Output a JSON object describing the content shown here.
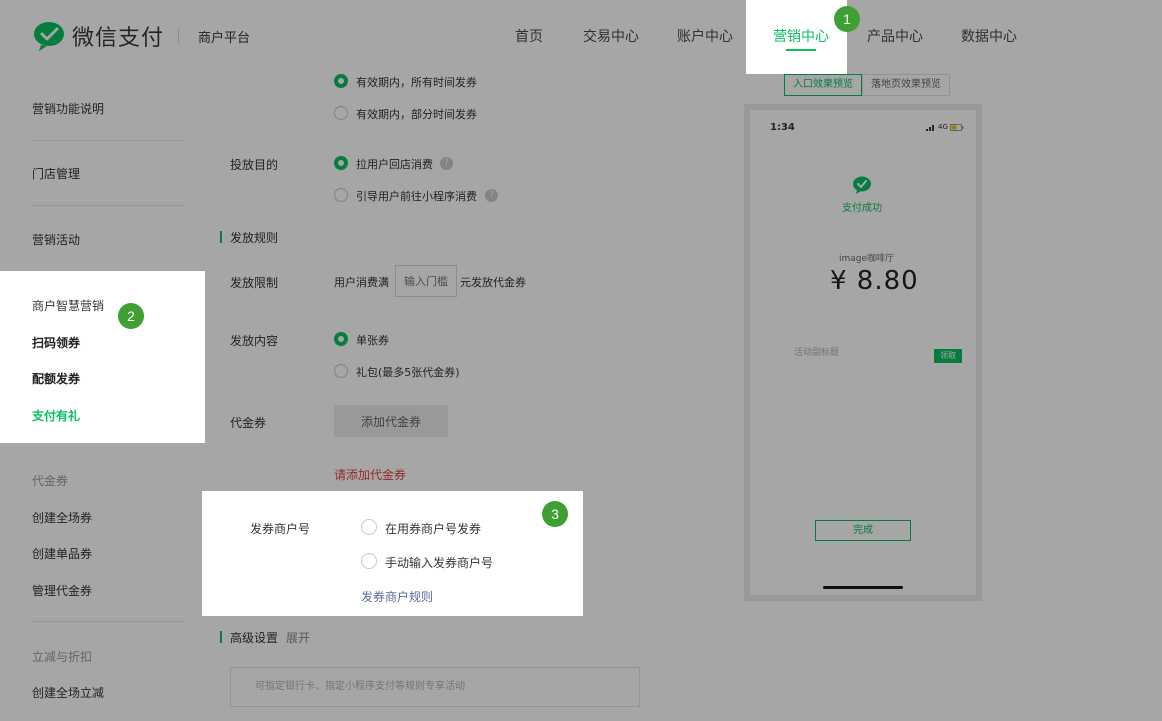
{
  "header": {
    "logo_text": "微信支付",
    "platform": "商户平台",
    "nav": [
      {
        "label": "首页"
      },
      {
        "label": "交易中心"
      },
      {
        "label": "账户中心"
      },
      {
        "label": "营销中心",
        "active": true
      },
      {
        "label": "产品中心"
      },
      {
        "label": "数据中心"
      }
    ]
  },
  "sidebar": {
    "items": [
      {
        "label": "营销功能说明"
      },
      {
        "label": "门店管理"
      },
      {
        "label": "营销活动"
      },
      {
        "label": "商户智慧营销"
      },
      {
        "label": "扫码领券"
      },
      {
        "label": "配额发券"
      },
      {
        "label": "支付有礼",
        "active": true
      },
      {
        "label": "代金券"
      },
      {
        "label": "创建全场券"
      },
      {
        "label": "创建单品券"
      },
      {
        "label": "管理代金券"
      },
      {
        "label": "立减与折扣"
      },
      {
        "label": "创建全场立减"
      }
    ]
  },
  "form": {
    "time_option_all": "有效期内，所有时间发券",
    "time_option_partial": "有效期内，部分时间发券",
    "purpose_label": "投放目的",
    "purpose_store": "拉用户回店消费",
    "purpose_miniprogram": "引导用户前往小程序消费",
    "rules_title": "发放规则",
    "limit_label": "发放限制",
    "limit_prefix": "用户消费满",
    "limit_placeholder": "输入门槛",
    "limit_suffix": "元发放代金券",
    "content_label": "发放内容",
    "content_single": "单张券",
    "content_package": "礼包(最多5张代金券)",
    "coupon_label": "代金券",
    "add_coupon": "添加代金券",
    "add_coupon_error": "请添加代金券",
    "issuer_label": "发券商户号",
    "issuer_in_use": "在用券商户号发券",
    "issuer_manual": "手动输入发券商户号",
    "issuer_rules": "发券商户规则",
    "advanced_title": "高级设置",
    "advanced_expand": "展开",
    "advanced_placeholder": "可指定银行卡、指定小程序支付等规则专享活动"
  },
  "preview": {
    "tab_entry": "入口效果预览",
    "tab_landing": "落地页效果预览",
    "time": "1:34",
    "signal": "4G",
    "pay_success": "支付成功",
    "merchant": "image咖啡厅",
    "amount": "¥ 8.80",
    "activity_title": "活动副标题",
    "claim": "领取",
    "done": "完成"
  },
  "badges": [
    "1",
    "2",
    "3"
  ],
  "colors": {
    "brand": "#07c160",
    "link": "#576b95",
    "error": "#e64340",
    "badge": "#3e9f32"
  }
}
